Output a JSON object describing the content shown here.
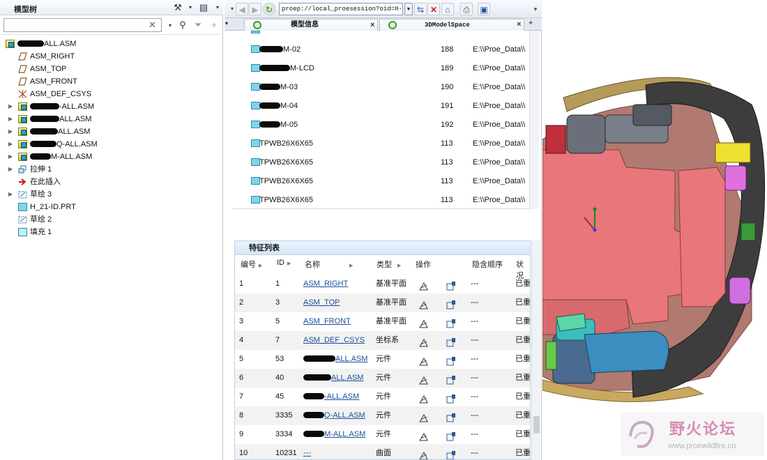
{
  "model_tree": {
    "title": "模型树",
    "search_value": "",
    "items": [
      {
        "label": "ALL.ASM",
        "icon": "assembly-icon",
        "indent": 0,
        "redact": 38,
        "expand": false
      },
      {
        "label": "ASM_RIGHT",
        "icon": "datum-plane-icon",
        "indent": 1,
        "expand": false
      },
      {
        "label": "ASM_TOP",
        "icon": "datum-plane-icon",
        "indent": 1,
        "expand": false
      },
      {
        "label": "ASM_FRONT",
        "icon": "datum-plane-icon",
        "indent": 1,
        "expand": false
      },
      {
        "label": "ASM_DEF_CSYS",
        "icon": "csys-icon",
        "indent": 1,
        "expand": false
      },
      {
        "label": "-ALL.ASM",
        "icon": "assembly-icon",
        "indent": 1,
        "redact": 42,
        "expand": true
      },
      {
        "label": "ALL.ASM",
        "icon": "assembly-icon",
        "indent": 1,
        "redact": 42,
        "expand": true
      },
      {
        "label": "ALL.ASM",
        "icon": "assembly-icon",
        "indent": 1,
        "redact": 40,
        "expand": true
      },
      {
        "label": "Q-ALL.ASM",
        "icon": "assembly-icon",
        "indent": 1,
        "redact": 38,
        "expand": true
      },
      {
        "label": "M-ALL.ASM",
        "icon": "assembly-icon",
        "indent": 1,
        "redact": 30,
        "expand": true
      },
      {
        "label": "拉伸 1",
        "icon": "extrude-icon",
        "indent": 1,
        "expand": true
      },
      {
        "label": "在此插入",
        "icon": "insert-here-arrow-icon",
        "indent": 1,
        "expand": false
      },
      {
        "label": "草绘 3",
        "icon": "sketch-icon",
        "indent": 1,
        "expand": true
      },
      {
        "label": "H_21-ID.PRT",
        "icon": "part-icon",
        "indent": 1,
        "expand": false
      },
      {
        "label": "草绘 2",
        "icon": "sketch-icon",
        "indent": 1,
        "expand": false
      },
      {
        "label": "填充 1",
        "icon": "fill-icon",
        "indent": 1,
        "expand": false
      }
    ]
  },
  "browser": {
    "url": "proep://local_proesession?oid=H-",
    "tabs": [
      {
        "label": "模型信息",
        "active": true
      },
      {
        "label": "3DModelSpace",
        "active": false
      }
    ]
  },
  "component_list": [
    {
      "name": "M-02",
      "redact": 34,
      "id": "188",
      "path": "E:\\\\Proe_Data\\\\"
    },
    {
      "name": "M-LCD",
      "redact": 44,
      "id": "189",
      "path": "E:\\\\Proe_Data\\\\"
    },
    {
      "name": "M-03",
      "redact": 30,
      "id": "190",
      "path": "E:\\\\Proe_Data\\\\"
    },
    {
      "name": "M-04",
      "redact": 30,
      "id": "191",
      "path": "E:\\\\Proe_Data\\\\"
    },
    {
      "name": "M-05",
      "redact": 30,
      "id": "192",
      "path": "E:\\\\Proe_Data\\\\"
    },
    {
      "name": "TPWB26X6X65",
      "redact": 0,
      "id": "113",
      "path": "E:\\\\Proe_Data\\\\"
    },
    {
      "name": "TPWB26X6X65",
      "redact": 0,
      "id": "113",
      "path": "E:\\\\Proe_Data\\\\"
    },
    {
      "name": "TPWB26X6X65",
      "redact": 0,
      "id": "113",
      "path": "E:\\\\Proe_Data\\\\"
    },
    {
      "name": "TPWB26X6X65",
      "redact": 0,
      "id": "113",
      "path": "E:\\\\Proe_Data\\\\"
    }
  ],
  "feature_list": {
    "title": "特征列表",
    "headers": {
      "num": "编号",
      "id": "ID",
      "name": "名称",
      "type": "类型",
      "op": "操作",
      "hide_order": "隐含顺序",
      "status": "状况"
    },
    "rows": [
      {
        "num": "1",
        "id": "1",
        "name": "ASM_RIGHT",
        "redact": 0,
        "type": "基准平面",
        "hide": "---",
        "status": "已重"
      },
      {
        "num": "2",
        "id": "3",
        "name": "ASM_TOP",
        "redact": 0,
        "type": "基准平面",
        "hide": "---",
        "status": "已重"
      },
      {
        "num": "3",
        "id": "5",
        "name": "ASM_FRONT",
        "redact": 0,
        "type": "基准平面",
        "hide": "---",
        "status": "已重"
      },
      {
        "num": "4",
        "id": "7",
        "name": "ASM_DEF_CSYS",
        "redact": 0,
        "type": "坐标系",
        "hide": "---",
        "status": "已重"
      },
      {
        "num": "5",
        "id": "53",
        "name": "ALL.ASM",
        "redact": 46,
        "type": "元件",
        "hide": "---",
        "status": "已重"
      },
      {
        "num": "6",
        "id": "40",
        "name": "ALL.ASM",
        "redact": 40,
        "type": "元件",
        "hide": "---",
        "status": "已重"
      },
      {
        "num": "7",
        "id": "45",
        "name": "-ALL.ASM",
        "redact": 30,
        "type": "元件",
        "hide": "---",
        "status": "已重"
      },
      {
        "num": "8",
        "id": "3335",
        "name": "Q-ALL.ASM",
        "redact": 30,
        "type": "元件",
        "hide": "---",
        "status": "已重"
      },
      {
        "num": "9",
        "id": "3334",
        "name": "M-ALL.ASM",
        "redact": 30,
        "type": "元件",
        "hide": "---",
        "status": "已重"
      },
      {
        "num": "10",
        "id": "10231",
        "name": "---",
        "redact": 0,
        "type": "曲面",
        "hide": "---",
        "status": "已重"
      }
    ]
  },
  "watermark": {
    "title": "野火论坛",
    "url": "www.proewildfire.cn"
  },
  "colors": {
    "model_body": "#e8767a",
    "model_ring": "#3b3b3b",
    "link": "#1a4f9a"
  }
}
